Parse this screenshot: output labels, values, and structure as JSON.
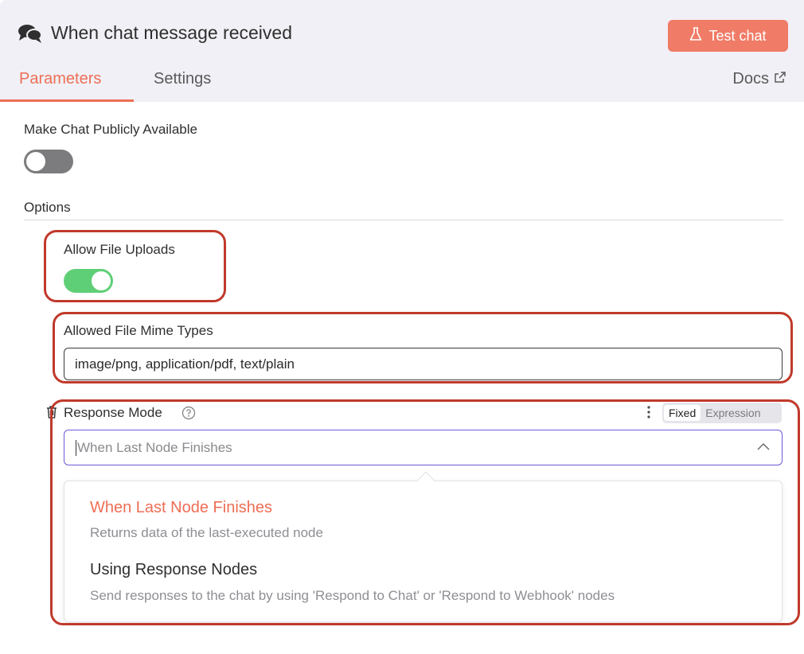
{
  "header": {
    "title": "When chat message received",
    "test_button_label": "Test chat",
    "icon": "chat-bubbles-icon"
  },
  "tabs": [
    {
      "label": "Parameters",
      "active": true
    },
    {
      "label": "Settings",
      "active": false
    }
  ],
  "docs_link": {
    "label": "Docs",
    "icon": "external-link-icon"
  },
  "public": {
    "label": "Make Chat Publicly Available",
    "enabled": false
  },
  "options": {
    "label": "Options",
    "allow_file_uploads": {
      "label": "Allow File Uploads",
      "enabled": true
    },
    "mime_types": {
      "label": "Allowed File Mime Types",
      "value": "image/png, application/pdf, text/plain"
    },
    "response_mode": {
      "label": "Response Mode",
      "placeholder": "When Last Node Finishes",
      "mode_toggle": {
        "fixed": "Fixed",
        "expression": "Expression",
        "selected": "Fixed"
      },
      "options": [
        {
          "title": "When Last Node Finishes",
          "description": "Returns data of the last-executed node",
          "selected": true
        },
        {
          "title": "Using Response Nodes",
          "description": "Send responses to the chat by using 'Respond to Chat' or 'Respond to Webhook' nodes",
          "selected": false
        }
      ]
    }
  },
  "colors": {
    "accent": "#ee6e55",
    "toggle_on": "#5fcf77",
    "toggle_off": "#7c7c7f",
    "select_border": "#6a5bd8",
    "annotation": "#c0392b"
  }
}
